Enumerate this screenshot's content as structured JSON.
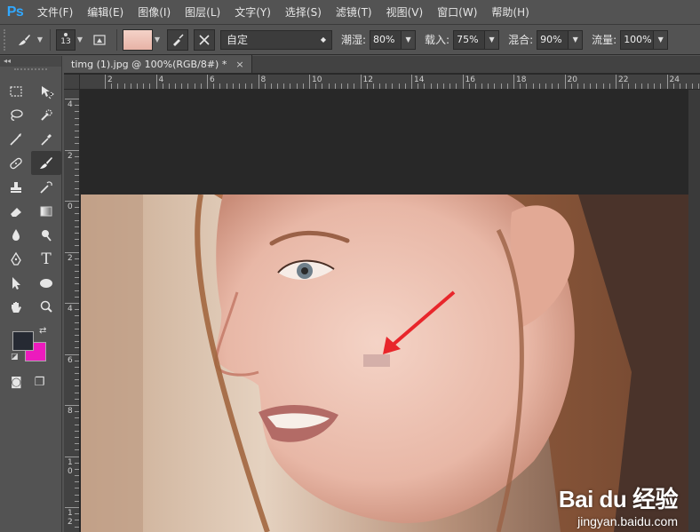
{
  "app": {
    "logo": "Ps",
    "accent": "#31a8ff"
  },
  "menu": [
    {
      "label": "文件(F)"
    },
    {
      "label": "编辑(E)"
    },
    {
      "label": "图像(I)"
    },
    {
      "label": "图层(L)"
    },
    {
      "label": "文字(Y)"
    },
    {
      "label": "选择(S)"
    },
    {
      "label": "滤镜(T)"
    },
    {
      "label": "视图(V)"
    },
    {
      "label": "窗口(W)"
    },
    {
      "label": "帮助(H)"
    }
  ],
  "options": {
    "tool_icon": "healing-brush-icon",
    "brush_size": "13",
    "mode_value": "自定",
    "fields": [
      {
        "label": "潮湿:",
        "value": "80%"
      },
      {
        "label": "载入:",
        "value": "75%"
      },
      {
        "label": "混合:",
        "value": "90%"
      },
      {
        "label": "流量:",
        "value": "100%"
      }
    ]
  },
  "toolbox": {
    "collapse_label": "◂◂",
    "fg_color": "#262a33",
    "bg_color": "#ec1bbd"
  },
  "document": {
    "tab_title": "timg (1).jpg @ 100%(RGB/8#) *",
    "close_glyph": "×",
    "ruler_top_labels": [
      "2",
      "4",
      "6",
      "8",
      "10",
      "12",
      "14",
      "16",
      "18",
      "20",
      "22",
      "24"
    ],
    "ruler_left_labels": [
      "4",
      "2",
      "0",
      "2",
      "4",
      "6",
      "8",
      "1\n0",
      "1\n2"
    ]
  },
  "watermark": {
    "brand": "Bai du 经验",
    "url": "jingyan.baidu.com"
  }
}
